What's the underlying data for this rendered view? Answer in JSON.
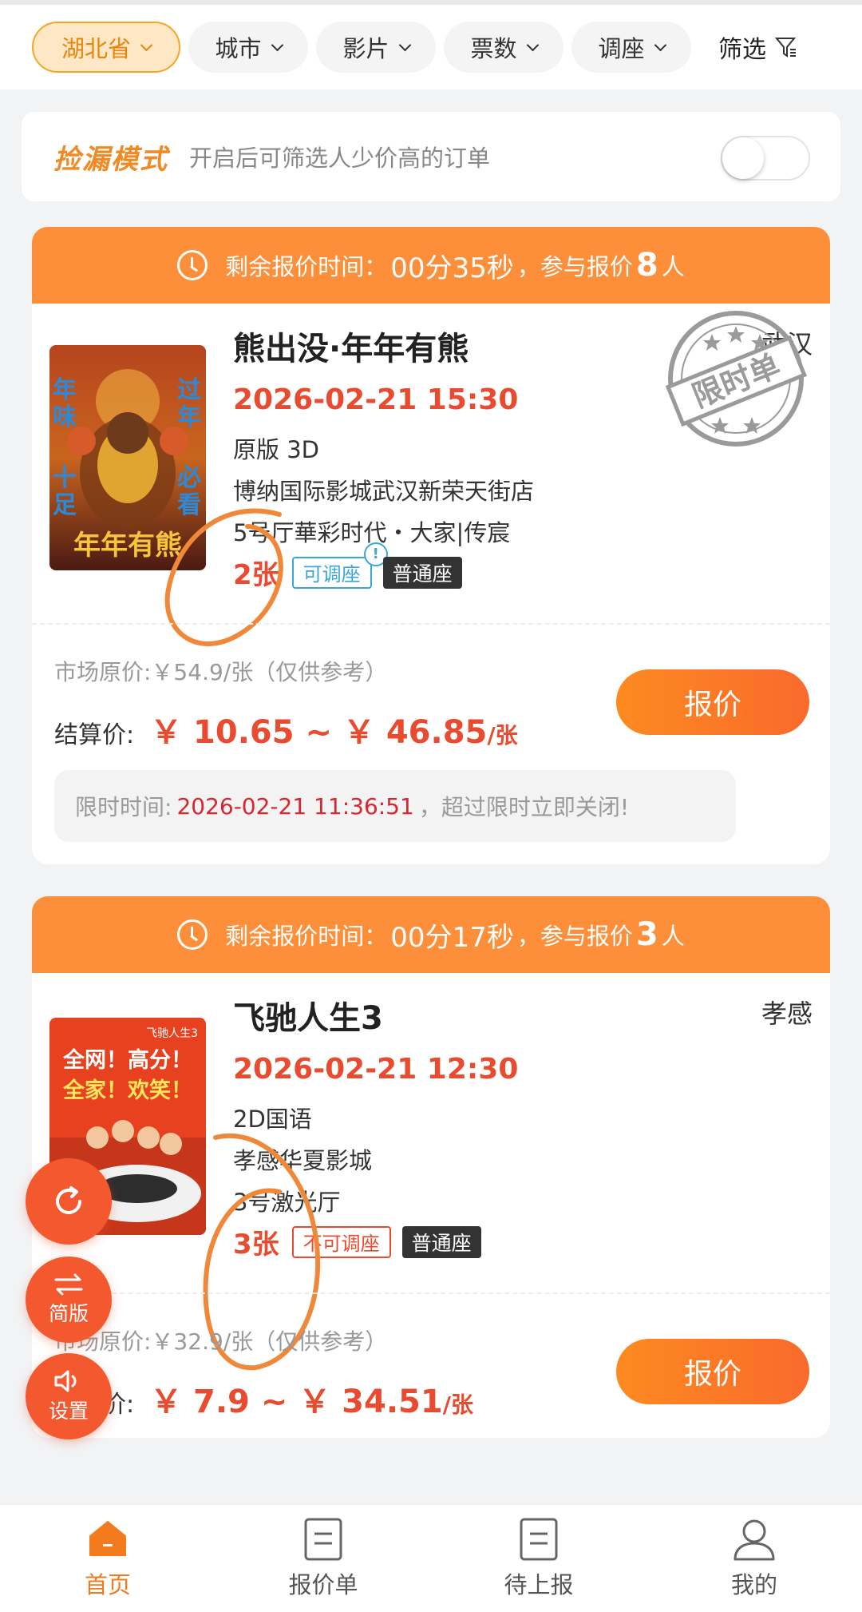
{
  "filters": {
    "province": "湖北省",
    "city": "城市",
    "film": "影片",
    "tickets": "票数",
    "seat": "调座",
    "filter_label": "筛选"
  },
  "mode": {
    "title": "捡漏模式",
    "description": "开启后可筛选人少价高的订单",
    "enabled": false
  },
  "orders": [
    {
      "countdown_prefix": "剩余报价时间：",
      "countdown": "00分35秒",
      "participants_prefix": "，参与报价",
      "participants": "8",
      "participants_suffix": "人",
      "title": "熊出没·年年有熊",
      "city": "武汉",
      "datetime": "2026-02-21 15:30",
      "format": "原版 3D",
      "cinema": "博纳国际影城武汉新荣天街店",
      "hall": "5号厅華彩时代・大家|传宸",
      "tickets": "2张",
      "seat_tag": "可调座",
      "seat_type": "普通座",
      "stamp": "限时单",
      "market_price": "市场原价:￥54.9/张（仅供参考）",
      "settle_label": "结算价:",
      "settle_price": "￥ 10.65 ~ ￥ 46.85",
      "settle_unit": "/张",
      "quote_button": "报价",
      "deadline_prefix": "限时时间:",
      "deadline": "2026-02-21 11:36:51",
      "deadline_suffix": "，超过限时立即关闭!",
      "poster_text": [
        "年",
        "味",
        "十",
        "足",
        "过",
        "年",
        "必",
        "看",
        "年年有熊"
      ]
    },
    {
      "countdown_prefix": "剩余报价时间：",
      "countdown": "00分17秒",
      "participants_prefix": "，参与报价",
      "participants": "3",
      "participants_suffix": "人",
      "title": "飞驰人生3",
      "city": "孝感",
      "datetime": "2026-02-21 12:30",
      "format": "2D国语",
      "cinema": "孝感华夏影城",
      "hall": "3号激光厅",
      "tickets": "3张",
      "seat_tag": "不可调座",
      "seat_type": "普通座",
      "market_price": "市场原价:￥32.9/张（仅供参考）",
      "settle_label": "结算价:",
      "settle_price": "￥ 7.9 ~ ￥ 34.51",
      "settle_unit": "/张",
      "quote_button": "报价",
      "poster_text": [
        "全网！高分！",
        "全家！欢笑！",
        "飞驰人生3"
      ]
    }
  ],
  "fabs": {
    "refresh": "",
    "simplified": "简版",
    "settings": "设置"
  },
  "nav": [
    {
      "label": "首页"
    },
    {
      "label": "报价单"
    },
    {
      "label": "待上报"
    },
    {
      "label": "我的"
    }
  ],
  "colors": {
    "accent": "#fd8f3a",
    "price_red": "#e84b2f",
    "active_nav": "#f37b1d"
  }
}
